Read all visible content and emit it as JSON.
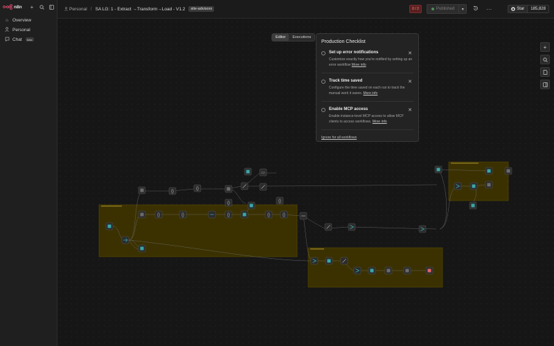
{
  "app": {
    "logo_text": "n8n"
  },
  "sidebar": {
    "items": [
      {
        "label": "Overview",
        "icon": "home-icon"
      },
      {
        "label": "Personal",
        "icon": "user-icon"
      },
      {
        "label": "Chat",
        "icon": "chat-icon",
        "badge": "beta"
      }
    ]
  },
  "header": {
    "project": "Personal",
    "workflow_name": "SA LG: 1 - Extract →Transform→Load - V1.2",
    "tag": "site-advisors",
    "alert_badge": "0 / 2",
    "publish_label": "Published",
    "github_star": "Star",
    "github_count": "185,828"
  },
  "tabs": [
    {
      "label": "Editor",
      "active": true
    },
    {
      "label": "Executions",
      "active": false
    }
  ],
  "checklist": {
    "title": "Production Checklist",
    "items": [
      {
        "title": "Set up error notifications",
        "description": "Customize exactly how you're notified by setting up an error workflow",
        "link": "More info"
      },
      {
        "title": "Track time saved",
        "description": "Configure the time saved on each run to track the manual work it saves.",
        "link": "More info"
      },
      {
        "title": "Enable MCP access",
        "description": "Enable instance-level MCP access to allow MCP clients to access workflows.",
        "link": "More info"
      }
    ],
    "ignore_label": "Ignore for all workflows"
  },
  "colors": {
    "sticky": "#3d3300",
    "sticky_border": "#5a4a00",
    "accent_teal": "#3aa7a7",
    "canvas": "#161616"
  }
}
